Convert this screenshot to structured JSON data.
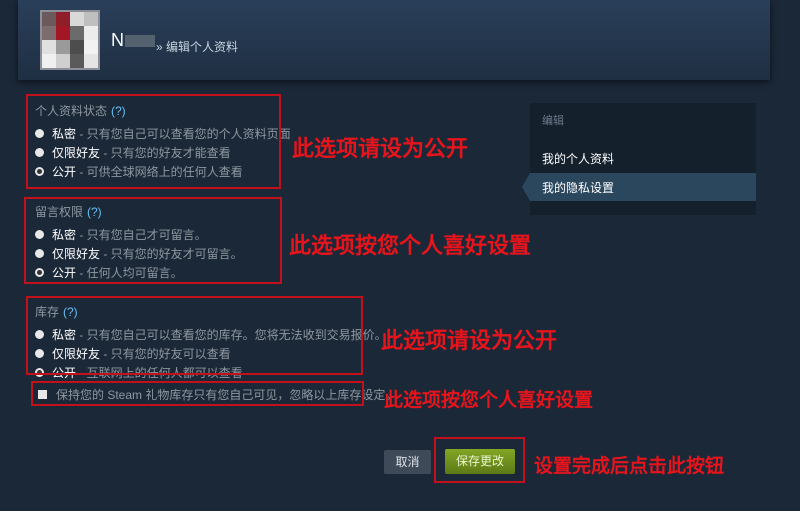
{
  "header": {
    "username": "N",
    "breadcrumb": "» 编辑个人资料"
  },
  "profile_state": {
    "title": "个人资料状态",
    "help": "(?)",
    "options": [
      {
        "name": "私密",
        "desc": " - 只有您自己可以查看您的个人资料页面",
        "selected": false
      },
      {
        "name": "仅限好友",
        "desc": " - 只有您的好友才能查看",
        "selected": false
      },
      {
        "name": "公开",
        "desc": " - 可供全球网络上的任何人查看",
        "selected": true
      }
    ]
  },
  "comment_permission": {
    "title": "留言权限",
    "help": "(?)",
    "options": [
      {
        "name": "私密",
        "desc": " - 只有您自己才可留言。",
        "selected": false
      },
      {
        "name": "仅限好友",
        "desc": " - 只有您的好友才可留言。",
        "selected": false
      },
      {
        "name": "公开",
        "desc": " - 任何人均可留言。",
        "selected": true
      }
    ]
  },
  "inventory": {
    "title": "库存",
    "help": "(?)",
    "options": [
      {
        "name": "私密",
        "desc": " - 只有您自己可以查看您的库存。您将无法收到交易报价。",
        "selected": false
      },
      {
        "name": "仅限好友",
        "desc": " - 只有您的好友可以查看",
        "selected": false
      },
      {
        "name": "公开",
        "desc": " - 互联网上的任何人都可以查看",
        "selected": true
      }
    ]
  },
  "gift_checkbox": {
    "label": "保持您的 Steam 礼物库存只有您自己可见，忽略以上库存设定。",
    "checked": false
  },
  "sidebar": {
    "heading": "编辑",
    "items": [
      {
        "label": "我的个人资料",
        "active": false
      },
      {
        "label": "我的隐私设置",
        "active": true
      }
    ]
  },
  "buttons": {
    "cancel": "取消",
    "save": "保存更改"
  },
  "annotations": {
    "profile_note": "此选项请设为公开",
    "comment_note": "此选项按您个人喜好设置",
    "inventory_note": "此选项请设为公开",
    "gift_note": "此选项按您个人喜好设置",
    "save_note": "设置完成后点击此按钮"
  },
  "colors": {
    "background": "#1b2838",
    "annotation_red": "#e8141c",
    "save_green": "#6f8f1e",
    "link_blue": "#66c0f4"
  }
}
